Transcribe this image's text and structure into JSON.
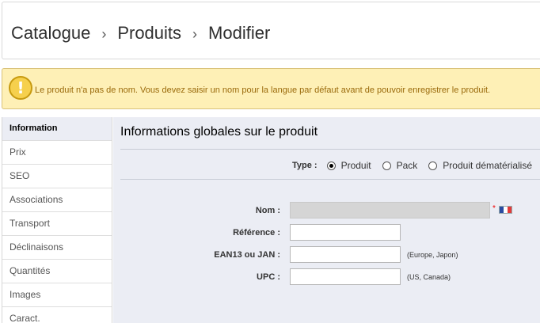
{
  "breadcrumb": {
    "items": [
      "Catalogue",
      "Produits",
      "Modifier"
    ],
    "separator": "›"
  },
  "warning": {
    "icon": "exclamation-icon",
    "message": "Le produit n'a pas de nom. Vous devez saisir un nom pour la langue par défaut avant de pouvoir enregistrer le produit."
  },
  "tabs": [
    {
      "label": "Information",
      "active": true
    },
    {
      "label": "Prix",
      "active": false
    },
    {
      "label": "SEO",
      "active": false
    },
    {
      "label": "Associations",
      "active": false
    },
    {
      "label": "Transport",
      "active": false
    },
    {
      "label": "Déclinaisons",
      "active": false
    },
    {
      "label": "Quantités",
      "active": false
    },
    {
      "label": "Images",
      "active": false
    },
    {
      "label": "Caract.",
      "active": false
    }
  ],
  "main": {
    "title": "Informations globales sur le produit",
    "type": {
      "label": "Type :",
      "options": [
        {
          "label": "Produit",
          "selected": true
        },
        {
          "label": "Pack",
          "selected": false
        },
        {
          "label": "Produit dématérialisé",
          "selected": false
        }
      ]
    },
    "fields": {
      "name": {
        "label": "Nom :",
        "value": "",
        "required_mark": "*",
        "language_flag": "france-flag-icon"
      },
      "reference": {
        "label": "Référence :",
        "value": ""
      },
      "ean13": {
        "label": "EAN13 ou JAN :",
        "value": "",
        "hint": "(Europe, Japon)"
      },
      "upc": {
        "label": "UPC :",
        "value": "",
        "hint": "(US, Canada)"
      }
    }
  },
  "colors": {
    "warning_bg": "#fef0b6",
    "warning_text": "#9a6a0b",
    "panel_bg": "#ebedf4",
    "required": "#ee0000",
    "flag": [
      "#2b4ba1",
      "#ffffff",
      "#e23a3a"
    ]
  }
}
